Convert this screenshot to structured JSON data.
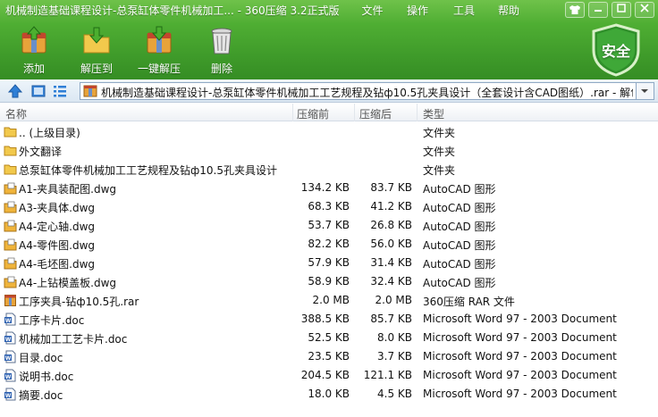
{
  "window": {
    "title": "机械制造基础课程设计-总泵缸体零件机械加工... - 360压缩 3.2正式版",
    "menu": [
      "文件",
      "操作",
      "工具",
      "帮助"
    ]
  },
  "toolbar": {
    "buttons": [
      {
        "label": "添加",
        "icon": "add-archive-icon"
      },
      {
        "label": "解压到",
        "icon": "extract-to-icon"
      },
      {
        "label": "一键解压",
        "icon": "one-click-extract-icon"
      },
      {
        "label": "删除",
        "icon": "delete-trash-icon"
      }
    ],
    "security_badge": "安全"
  },
  "address": {
    "path": "机械制造基础课程设计-总泵缸体零件机械加工工艺规程及钻ф10.5孔夹具设计（全套设计含CAD图纸）.rar - 解包大小"
  },
  "columns": {
    "name": "名称",
    "original_size": "压缩前",
    "compressed_size": "压缩后",
    "type": "类型"
  },
  "files": [
    {
      "name": ".. (上级目录)",
      "size": "",
      "csize": "",
      "type": "文件夹",
      "icon": "folder-up"
    },
    {
      "name": "外文翻译",
      "size": "",
      "csize": "",
      "type": "文件夹",
      "icon": "folder"
    },
    {
      "name": "总泵缸体零件机械加工工艺规程及钻ф10.5孔夹具设计",
      "size": "",
      "csize": "",
      "type": "文件夹",
      "icon": "folder"
    },
    {
      "name": "A1-夹具装配图.dwg",
      "size": "134.2 KB",
      "csize": "83.7 KB",
      "type": "AutoCAD 图形",
      "icon": "dwg"
    },
    {
      "name": "A3-夹具体.dwg",
      "size": "68.3 KB",
      "csize": "41.2 KB",
      "type": "AutoCAD 图形",
      "icon": "dwg"
    },
    {
      "name": "A4-定心轴.dwg",
      "size": "53.7 KB",
      "csize": "26.8 KB",
      "type": "AutoCAD 图形",
      "icon": "dwg"
    },
    {
      "name": "A4-零件图.dwg",
      "size": "82.2 KB",
      "csize": "56.0 KB",
      "type": "AutoCAD 图形",
      "icon": "dwg"
    },
    {
      "name": "A4-毛坯图.dwg",
      "size": "57.9 KB",
      "csize": "31.4 KB",
      "type": "AutoCAD 图形",
      "icon": "dwg"
    },
    {
      "name": "A4-上钻模盖板.dwg",
      "size": "58.9 KB",
      "csize": "32.4 KB",
      "type": "AutoCAD 图形",
      "icon": "dwg"
    },
    {
      "name": "工序夹具-钻ф10.5孔.rar",
      "size": "2.0 MB",
      "csize": "2.0 MB",
      "type": "360压缩 RAR 文件",
      "icon": "rar"
    },
    {
      "name": "工序卡片.doc",
      "size": "388.5 KB",
      "csize": "85.7 KB",
      "type": "Microsoft Word 97 - 2003 Document",
      "icon": "doc"
    },
    {
      "name": "机械加工工艺卡片.doc",
      "size": "52.5 KB",
      "csize": "8.0 KB",
      "type": "Microsoft Word 97 - 2003 Document",
      "icon": "doc"
    },
    {
      "name": "目录.doc",
      "size": "23.5 KB",
      "csize": "3.7 KB",
      "type": "Microsoft Word 97 - 2003 Document",
      "icon": "doc"
    },
    {
      "name": "说明书.doc",
      "size": "204.5 KB",
      "csize": "121.1 KB",
      "type": "Microsoft Word 97 - 2003 Document",
      "icon": "doc"
    },
    {
      "name": "摘要.doc",
      "size": "18.0 KB",
      "csize": "4.5 KB",
      "type": "Microsoft Word 97 - 2003 Document",
      "icon": "doc"
    }
  ],
  "colors": {
    "chrome_green": "#3f9b2a",
    "badge_green": "#2f8f2a",
    "folder_yellow": "#f2c94c",
    "dwg_yellow": "#f0b43a",
    "doc_blue": "#2b5fb0"
  }
}
